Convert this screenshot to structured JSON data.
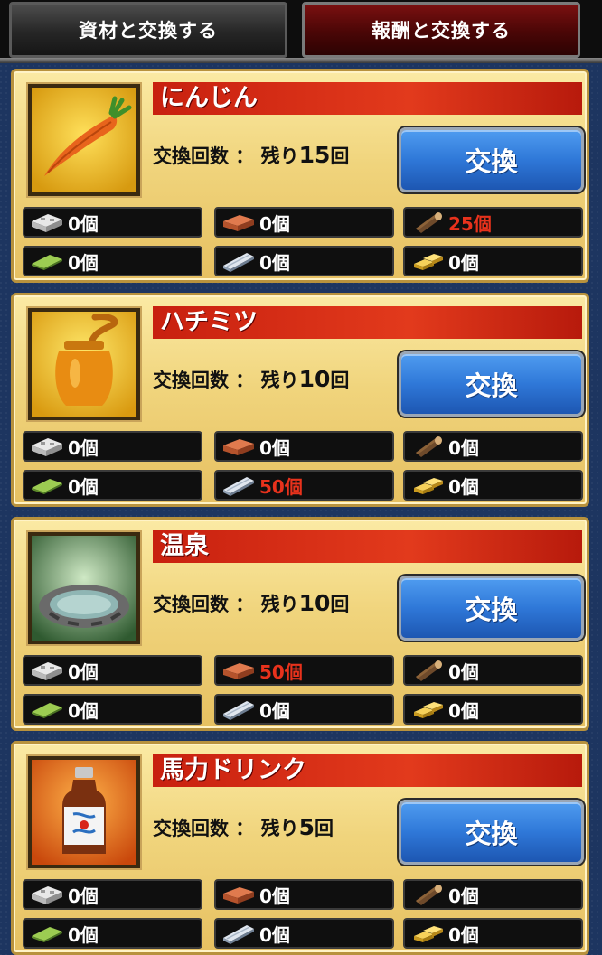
{
  "tabs": [
    {
      "label": "資材と交換する",
      "active": false
    },
    {
      "label": "報酬と交換する",
      "active": true
    }
  ],
  "exchange_label": "交換",
  "count_prefix": "交換回数 ： 残り",
  "count_suffix": "回",
  "resource_icons": [
    "concrete-block-icon",
    "brick-icon",
    "log-icon",
    "green-sheet-icon",
    "steel-beam-icon",
    "gold-bar-icon"
  ],
  "cards": [
    {
      "name": "にんじん",
      "icon": "carrot-icon",
      "remaining": "15",
      "resources": [
        "0個",
        "0個",
        "25個",
        "0個",
        "0個",
        "0個"
      ],
      "highlight": [
        false,
        false,
        true,
        false,
        false,
        false
      ]
    },
    {
      "name": "ハチミツ",
      "icon": "honey-jar-icon",
      "remaining": "10",
      "resources": [
        "0個",
        "0個",
        "0個",
        "0個",
        "50個",
        "0個"
      ],
      "highlight": [
        false,
        false,
        false,
        false,
        true,
        false
      ]
    },
    {
      "name": "温泉",
      "icon": "hot-spring-icon",
      "remaining": "10",
      "resources": [
        "0個",
        "50個",
        "0個",
        "0個",
        "0個",
        "0個"
      ],
      "highlight": [
        false,
        true,
        false,
        false,
        false,
        false
      ]
    },
    {
      "name": "馬力ドリンク",
      "icon": "energy-drink-icon",
      "remaining": "5",
      "resources": [
        "0個",
        "0個",
        "0個",
        "0個",
        "0個",
        "0個"
      ],
      "highlight": [
        false,
        false,
        false,
        false,
        false,
        false
      ]
    }
  ],
  "colors": {
    "highlight_red": "#e8321c",
    "button_blue": "#2f78d8",
    "banner_red": "#d42a15"
  }
}
